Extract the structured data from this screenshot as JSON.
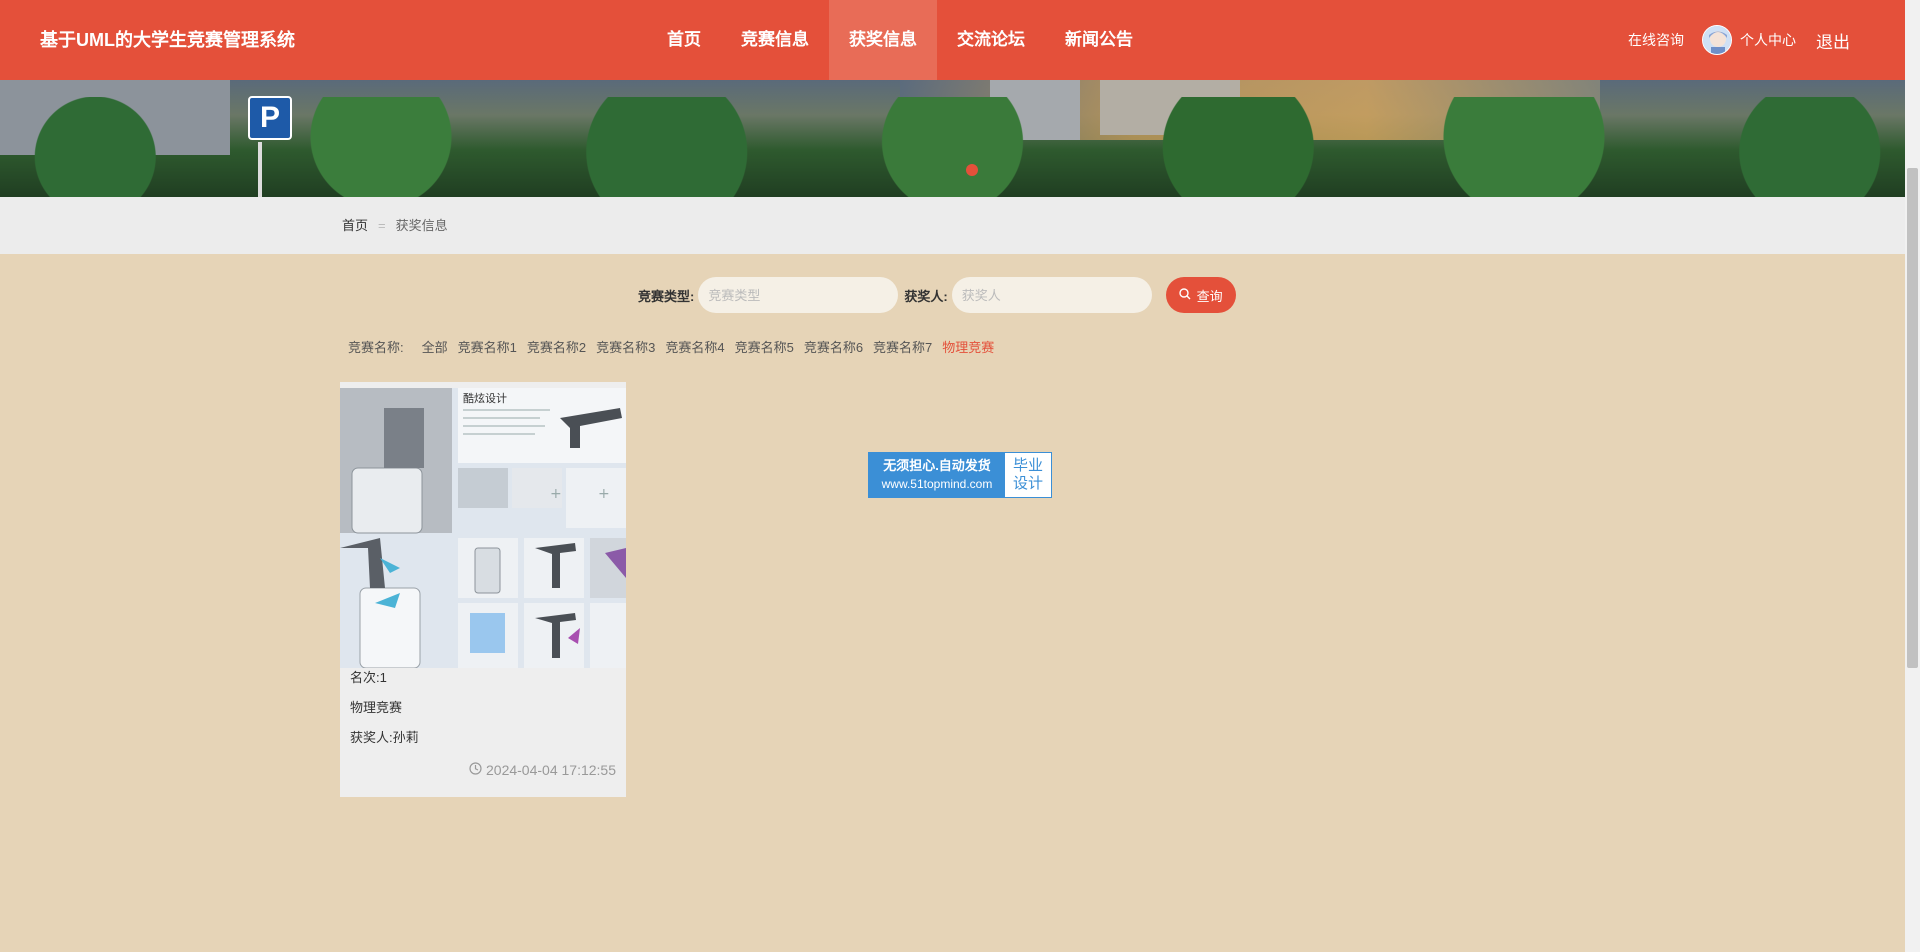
{
  "header": {
    "brand": "基于UML的大学生竞赛管理系统",
    "nav": [
      {
        "label": "首页",
        "active": false
      },
      {
        "label": "竞赛信息",
        "active": false
      },
      {
        "label": "获奖信息",
        "active": true
      },
      {
        "label": "交流论坛",
        "active": false
      },
      {
        "label": "新闻公告",
        "active": false
      }
    ],
    "consult": "在线咨询",
    "center": "个人中心",
    "logout": "退出",
    "color": "#e4503a"
  },
  "banner": {
    "sign_letter": "P"
  },
  "breadcrumb": {
    "home": "首页",
    "separator": "=",
    "current": "获奖信息"
  },
  "search": {
    "type_label": "竞赛类型:",
    "type_placeholder": "竞赛类型",
    "winner_label": "获奖人:",
    "winner_placeholder": "获奖人",
    "button": "查询"
  },
  "filter": {
    "title": "竞赛名称:",
    "options": [
      "全部",
      "竞赛名称1",
      "竞赛名称2",
      "竞赛名称3",
      "竞赛名称4",
      "竞赛名称5",
      "竞赛名称6",
      "竞赛名称7",
      "物理竞赛"
    ],
    "active_index": 8
  },
  "cards": [
    {
      "rank": "名次:1",
      "competition": "物理竞赛",
      "winner": "获奖人:孙莉",
      "time": "2024-04-04 17:12:55",
      "poster_title": "酷炫设计"
    }
  ],
  "ad": {
    "line1": "无须担心.自动发货",
    "line2": "www.51topmind.com",
    "right1": "毕业",
    "right2": "设计"
  }
}
